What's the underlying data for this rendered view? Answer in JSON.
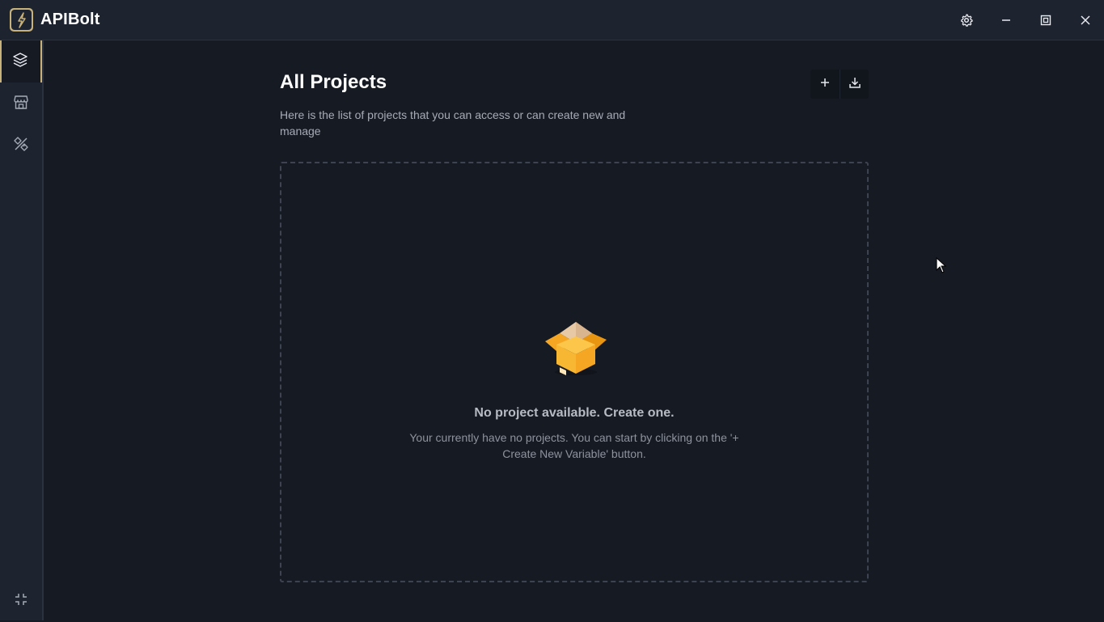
{
  "app": {
    "title": "APIBolt"
  },
  "window_controls": {
    "settings_icon": "gear-icon",
    "minimize_icon": "minimize-icon",
    "maximize_icon": "maximize-icon",
    "close_icon": "close-icon"
  },
  "sidebar": {
    "items": [
      {
        "icon": "layers-icon",
        "active": true
      },
      {
        "icon": "store-icon",
        "active": false
      },
      {
        "icon": "tools-icon",
        "active": false
      }
    ],
    "bottom_icon": "collapse-icon"
  },
  "main": {
    "title": "All Projects",
    "description": "Here is the list of projects that you can access or can create new and manage",
    "actions": [
      {
        "icon": "plus-icon"
      },
      {
        "icon": "download-icon"
      }
    ],
    "empty_state": {
      "icon": "open-box-icon",
      "title": "No project available. Create one.",
      "description": "Your currently have no projects. You can start by clicking on the '+ Create New Variable' button."
    }
  },
  "colors": {
    "accent": "#c9b27a",
    "background": "#161a23",
    "titlebar": "#1d2430",
    "box_orange": "#f5a623"
  }
}
